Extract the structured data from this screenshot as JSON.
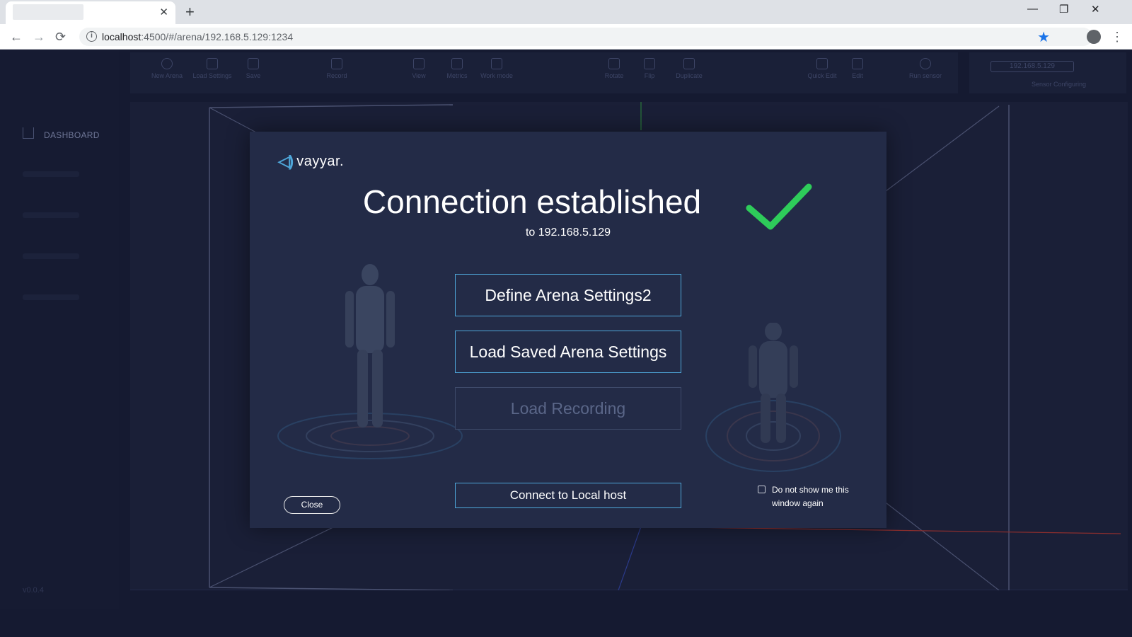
{
  "browser": {
    "tab_close": "✕",
    "new_tab": "+",
    "window_controls": [
      "—",
      "❐",
      "✕"
    ],
    "url_host": "localhost",
    "url_path": ":4500/#/arena/192.168.5.129:1234",
    "nav": {
      "back": "←",
      "forward": "→",
      "reload": "⟳"
    },
    "star": "★",
    "menu": "⋮"
  },
  "sidebar": {
    "active_label": "DASHBOARD",
    "version": "v0.0.4"
  },
  "toolbar": {
    "items": [
      {
        "label": "New Arena",
        "icon": "plus-circle-icon"
      },
      {
        "label": "Load Settings",
        "icon": "load-icon"
      },
      {
        "label": "Save",
        "icon": "save-icon"
      },
      {
        "label": "Record",
        "icon": "record-icon"
      },
      {
        "label": "View",
        "icon": "cube-icon"
      },
      {
        "label": "Metrics",
        "icon": "sliders-icon"
      },
      {
        "label": "Work mode",
        "icon": "wm-icon"
      },
      {
        "label": "Rotate",
        "icon": "rotate-icon"
      },
      {
        "label": "Flip",
        "icon": "flip-icon"
      },
      {
        "label": "Duplicate",
        "icon": "duplicate-icon"
      },
      {
        "label": "Quick Edit",
        "icon": "quick-edit-icon"
      },
      {
        "label": "Edit",
        "icon": "pencil-icon"
      },
      {
        "label": "Run sensor",
        "icon": "play-icon"
      }
    ],
    "sensor_ip": "192.168.5.129",
    "sensor_status": "Sensor Configuring"
  },
  "modal": {
    "logo_text": "vayyar.",
    "title": "Connection established",
    "subtitle": "to 192.168.5.129",
    "buttons": {
      "define": "Define Arena Settings2",
      "load_saved": "Load Saved Arena Settings",
      "load_recording": "Load Recording",
      "connect_local": "Connect to Local host",
      "close": "Close"
    },
    "checkbox_label": "Do not show me this window again",
    "checkbox_checked": false,
    "colors": {
      "accent": "#4ea6d9",
      "check": "#2ecc5a",
      "panel": "#232b47"
    }
  }
}
